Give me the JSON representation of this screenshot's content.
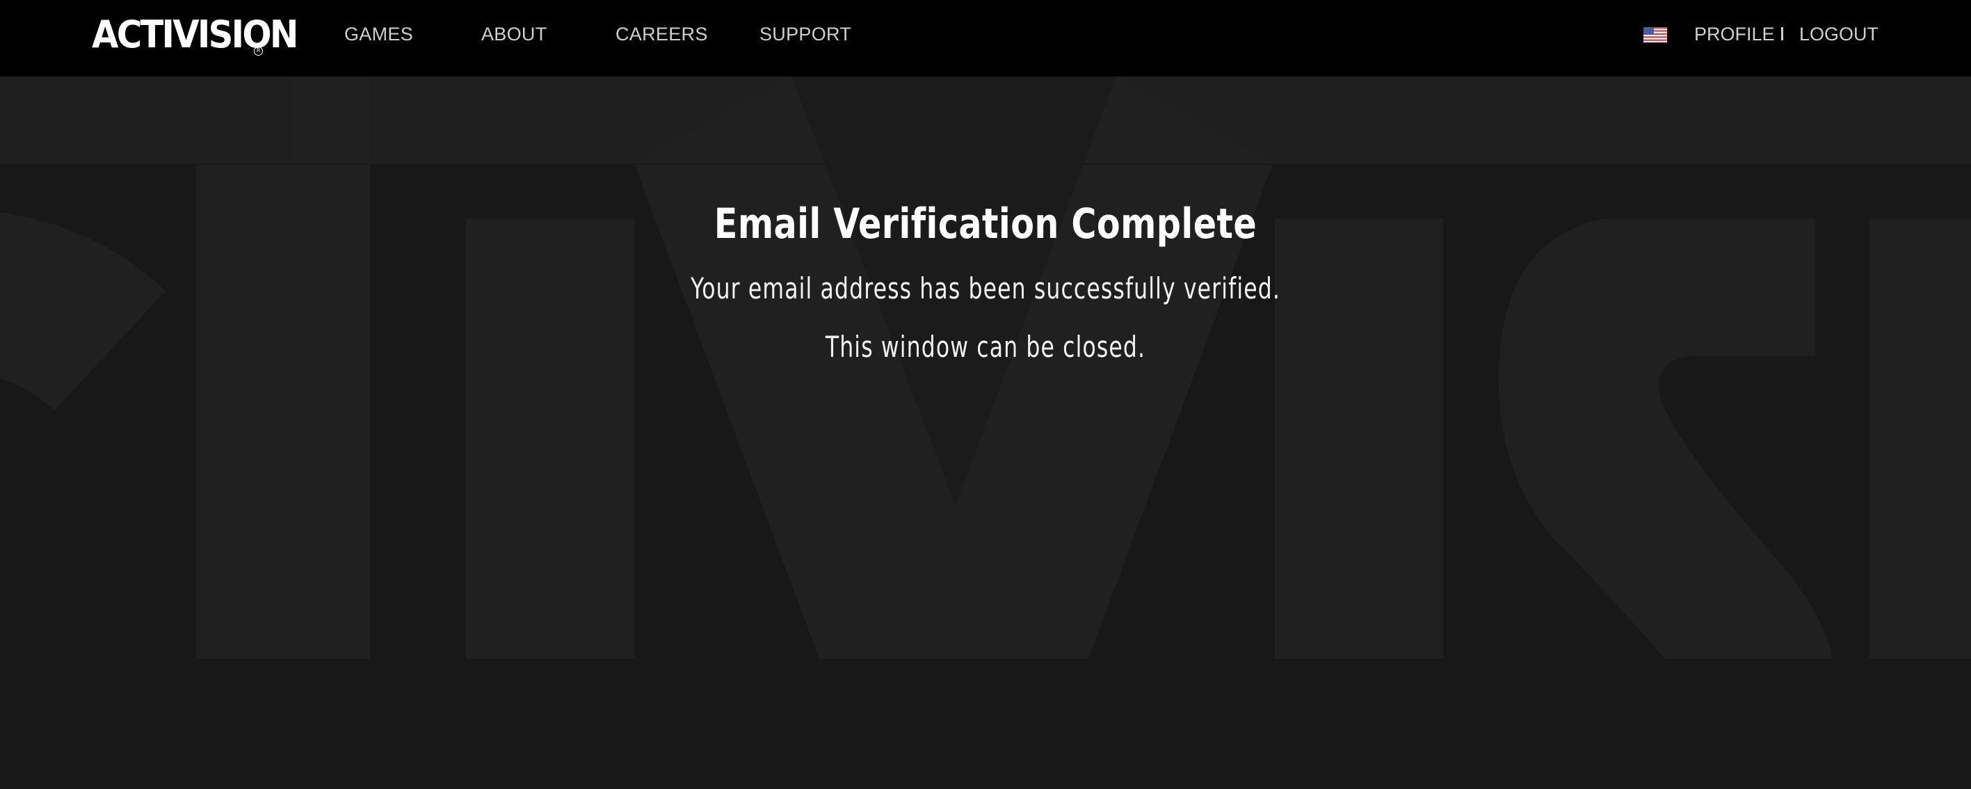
{
  "header": {
    "logo": {
      "text": "ACTIVISION",
      "registered_mark": "R"
    },
    "nav": {
      "games": "GAMES",
      "about": "ABOUT",
      "careers": "CAREERS",
      "support": "SUPPORT"
    },
    "region_icon": "us-flag-icon",
    "profile": "PROFILE",
    "separator": "I",
    "logout": "LOGOUT"
  },
  "main": {
    "title": "Email Verification Complete",
    "message_line_1": "Your email address has been successfully verified.",
    "message_line_2": "This window can be closed."
  },
  "colors": {
    "header_bg": "#000000",
    "page_bg": "#181818",
    "watermark": "#202020",
    "text_primary": "#ffffff",
    "nav_text": "#cfcfcf"
  }
}
